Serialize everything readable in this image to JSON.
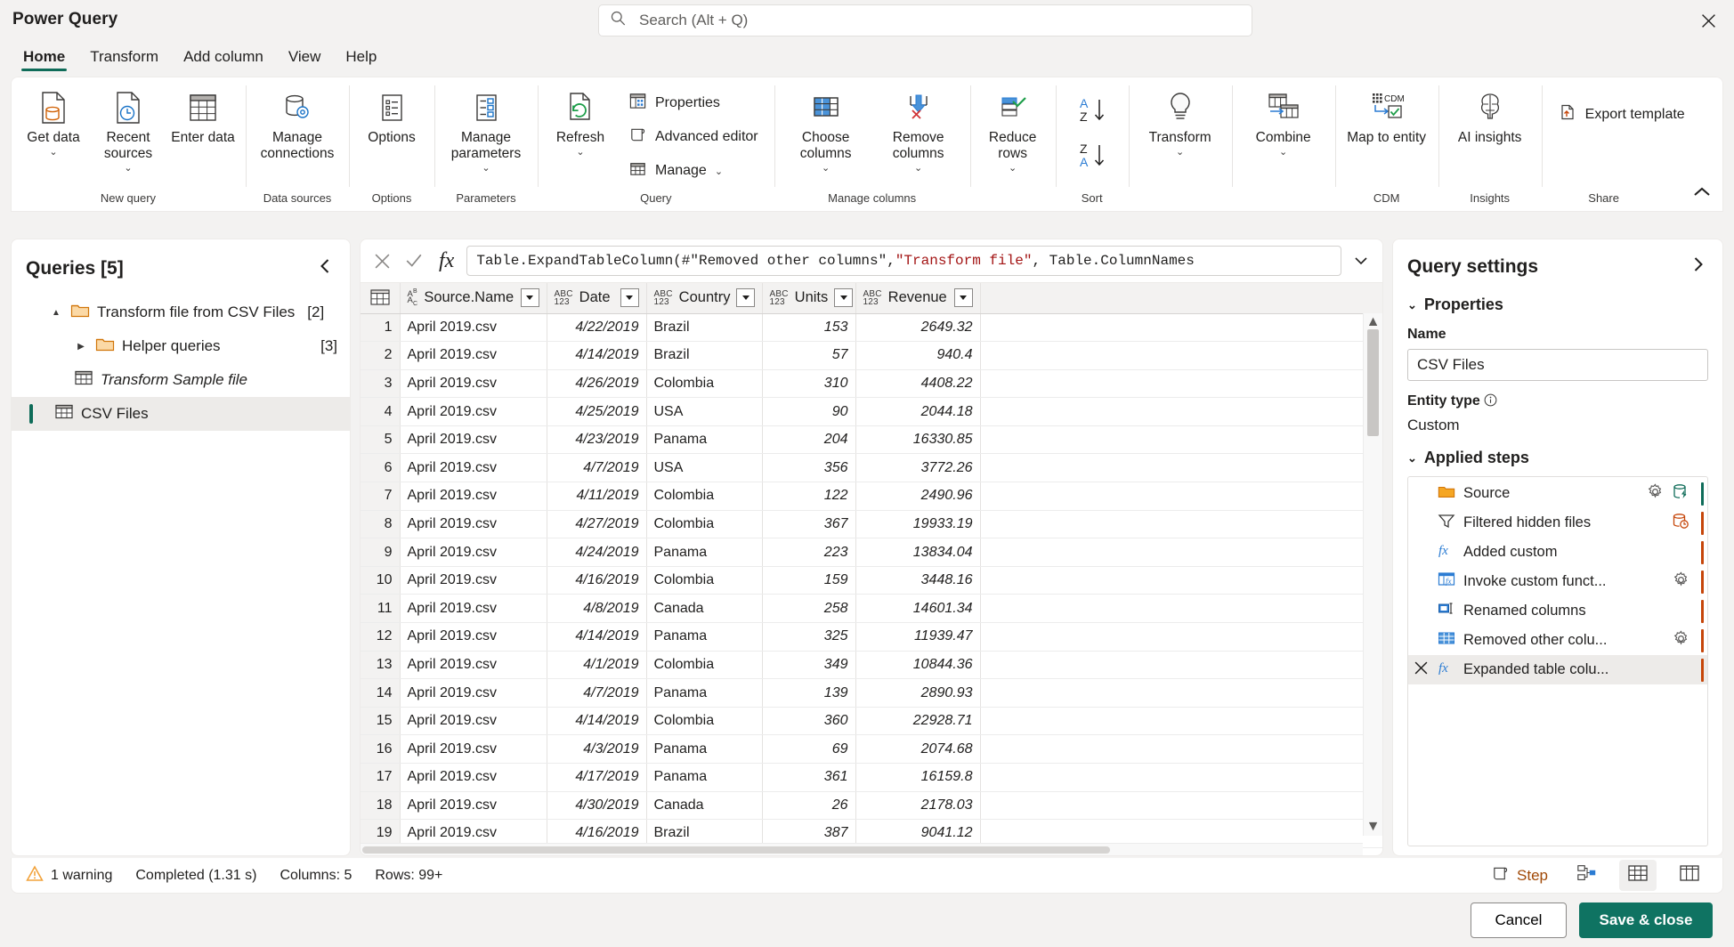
{
  "window": {
    "title": "Power Query",
    "close_label": "✕"
  },
  "search": {
    "placeholder": "Search (Alt + Q)",
    "icon": "search-icon"
  },
  "tabs": [
    {
      "label": "Home",
      "active": true
    },
    {
      "label": "Transform",
      "active": false
    },
    {
      "label": "Add column",
      "active": false
    },
    {
      "label": "View",
      "active": false
    },
    {
      "label": "Help",
      "active": false
    }
  ],
  "ribbon": {
    "collapse_icon": "chevron-up-icon",
    "groups": [
      {
        "name": "New query",
        "buttons": [
          {
            "label": "Get data",
            "caret": true,
            "icon": "get-data-icon"
          },
          {
            "label": "Recent sources",
            "caret": true,
            "icon": "recent-sources-icon"
          },
          {
            "label": "Enter data",
            "caret": false,
            "icon": "enter-data-icon"
          }
        ]
      },
      {
        "name": "Data sources",
        "buttons": [
          {
            "label": "Manage connections",
            "caret": false,
            "icon": "manage-connections-icon"
          }
        ]
      },
      {
        "name": "Options",
        "buttons": [
          {
            "label": "Options",
            "caret": false,
            "icon": "options-icon"
          }
        ]
      },
      {
        "name": "Parameters",
        "buttons": [
          {
            "label": "Manage parameters",
            "caret": true,
            "icon": "manage-parameters-icon"
          }
        ]
      },
      {
        "name": "Query",
        "buttons": [
          {
            "label": "Refresh",
            "caret": true,
            "icon": "refresh-icon"
          }
        ],
        "small_buttons": [
          {
            "label": "Properties",
            "icon": "properties-icon",
            "caret": false
          },
          {
            "label": "Advanced editor",
            "icon": "advanced-editor-icon",
            "caret": false
          },
          {
            "label": "Manage",
            "icon": "manage-icon",
            "caret": true
          }
        ]
      },
      {
        "name": "Manage columns",
        "buttons": [
          {
            "label": "Choose columns",
            "caret": true,
            "icon": "choose-columns-icon"
          },
          {
            "label": "Remove columns",
            "caret": true,
            "icon": "remove-columns-icon"
          }
        ]
      },
      {
        "name": "",
        "buttons": [
          {
            "label": "Reduce rows",
            "caret": true,
            "icon": "reduce-rows-icon"
          }
        ]
      },
      {
        "name": "Sort",
        "sort_buttons": [
          {
            "label": "sort-ascending",
            "icon": "sort-az-icon"
          },
          {
            "label": "sort-descending",
            "icon": "sort-za-icon"
          }
        ]
      },
      {
        "name": "",
        "buttons": [
          {
            "label": "Transform",
            "caret": true,
            "icon": "transform-bulb-icon"
          }
        ]
      },
      {
        "name": "",
        "buttons": [
          {
            "label": "Combine",
            "caret": true,
            "icon": "combine-icon"
          }
        ]
      },
      {
        "name": "CDM",
        "buttons": [
          {
            "label": "Map to entity",
            "caret": false,
            "icon": "map-to-entity-icon"
          }
        ]
      },
      {
        "name": "Insights",
        "buttons": [
          {
            "label": "AI insights",
            "caret": false,
            "icon": "ai-insights-icon"
          }
        ]
      },
      {
        "name": "Share",
        "small_buttons": [
          {
            "label": "Export template",
            "icon": "export-template-icon",
            "caret": false
          }
        ]
      }
    ]
  },
  "queries_pane": {
    "title": "Queries [5]",
    "collapse_icon": "chevron-left-icon",
    "items": [
      {
        "label": "Transform file from CSV Files",
        "count": "[2]",
        "icon": "folder-icon",
        "twisty": "▲",
        "indent": 1,
        "selected": false,
        "italic": false
      },
      {
        "label": "Helper queries",
        "count": "[3]",
        "icon": "folder-icon",
        "twisty": "▶",
        "indent": 2,
        "selected": false,
        "italic": false
      },
      {
        "label": "Transform Sample file",
        "count": "",
        "icon": "table-icon",
        "twisty": "",
        "indent": 2,
        "selected": false,
        "italic": true
      },
      {
        "label": "CSV Files",
        "count": "",
        "icon": "table-icon",
        "twisty": "",
        "indent": 1,
        "selected": true,
        "italic": false
      }
    ]
  },
  "formula_bar": {
    "cancel_icon": "cancel-icon",
    "accept_icon": "checkmark-icon",
    "fx_label": "fx",
    "expand_icon": "chevron-down-icon",
    "text_before": "Table.ExpandTableColumn(#\"Removed other columns\", ",
    "text_string": "\"Transform file\"",
    "text_after": ", Table.ColumnNames"
  },
  "grid": {
    "columns": [
      {
        "name": "Source.Name",
        "type_icon": "text-type-icon",
        "type_label": "ABC",
        "selected": true,
        "align": "left"
      },
      {
        "name": "Date",
        "type_icon": "any-type-icon",
        "type_label": "ABC123",
        "selected": false,
        "align": "right"
      },
      {
        "name": "Country",
        "type_icon": "any-type-icon",
        "type_label": "ABC123",
        "selected": false,
        "align": "left"
      },
      {
        "name": "Units",
        "type_icon": "any-type-icon",
        "type_label": "ABC123",
        "selected": false,
        "align": "right"
      },
      {
        "name": "Revenue",
        "type_icon": "any-type-icon",
        "type_label": "ABC123",
        "selected": false,
        "align": "right"
      }
    ],
    "rows": [
      {
        "n": "1",
        "source": "April 2019.csv",
        "date": "4/22/2019",
        "country": "Brazil",
        "units": "153",
        "revenue": "2649.32"
      },
      {
        "n": "2",
        "source": "April 2019.csv",
        "date": "4/14/2019",
        "country": "Brazil",
        "units": "57",
        "revenue": "940.4"
      },
      {
        "n": "3",
        "source": "April 2019.csv",
        "date": "4/26/2019",
        "country": "Colombia",
        "units": "310",
        "revenue": "4408.22"
      },
      {
        "n": "4",
        "source": "April 2019.csv",
        "date": "4/25/2019",
        "country": "USA",
        "units": "90",
        "revenue": "2044.18"
      },
      {
        "n": "5",
        "source": "April 2019.csv",
        "date": "4/23/2019",
        "country": "Panama",
        "units": "204",
        "revenue": "16330.85"
      },
      {
        "n": "6",
        "source": "April 2019.csv",
        "date": "4/7/2019",
        "country": "USA",
        "units": "356",
        "revenue": "3772.26"
      },
      {
        "n": "7",
        "source": "April 2019.csv",
        "date": "4/11/2019",
        "country": "Colombia",
        "units": "122",
        "revenue": "2490.96"
      },
      {
        "n": "8",
        "source": "April 2019.csv",
        "date": "4/27/2019",
        "country": "Colombia",
        "units": "367",
        "revenue": "19933.19"
      },
      {
        "n": "9",
        "source": "April 2019.csv",
        "date": "4/24/2019",
        "country": "Panama",
        "units": "223",
        "revenue": "13834.04"
      },
      {
        "n": "10",
        "source": "April 2019.csv",
        "date": "4/16/2019",
        "country": "Colombia",
        "units": "159",
        "revenue": "3448.16"
      },
      {
        "n": "11",
        "source": "April 2019.csv",
        "date": "4/8/2019",
        "country": "Canada",
        "units": "258",
        "revenue": "14601.34"
      },
      {
        "n": "12",
        "source": "April 2019.csv",
        "date": "4/14/2019",
        "country": "Panama",
        "units": "325",
        "revenue": "11939.47"
      },
      {
        "n": "13",
        "source": "April 2019.csv",
        "date": "4/1/2019",
        "country": "Colombia",
        "units": "349",
        "revenue": "10844.36"
      },
      {
        "n": "14",
        "source": "April 2019.csv",
        "date": "4/7/2019",
        "country": "Panama",
        "units": "139",
        "revenue": "2890.93"
      },
      {
        "n": "15",
        "source": "April 2019.csv",
        "date": "4/14/2019",
        "country": "Colombia",
        "units": "360",
        "revenue": "22928.71"
      },
      {
        "n": "16",
        "source": "April 2019.csv",
        "date": "4/3/2019",
        "country": "Panama",
        "units": "69",
        "revenue": "2074.68"
      },
      {
        "n": "17",
        "source": "April 2019.csv",
        "date": "4/17/2019",
        "country": "Panama",
        "units": "361",
        "revenue": "16159.8"
      },
      {
        "n": "18",
        "source": "April 2019.csv",
        "date": "4/30/2019",
        "country": "Canada",
        "units": "26",
        "revenue": "2178.03"
      },
      {
        "n": "19",
        "source": "April 2019.csv",
        "date": "4/16/2019",
        "country": "Brazil",
        "units": "387",
        "revenue": "9041.12"
      }
    ]
  },
  "query_settings": {
    "title": "Query settings",
    "expand_icon": "chevron-right-icon",
    "properties_section": "Properties",
    "name_label": "Name",
    "name_value": "CSV Files",
    "entity_label": "Entity type",
    "entity_value": "Custom",
    "applied_steps_section": "Applied steps",
    "steps": [
      {
        "label": "Source",
        "icon": "folder-icon",
        "gear": true,
        "extra_icon": "database-lightning-icon",
        "bar": "teal",
        "active": false,
        "deletable": false
      },
      {
        "label": "Filtered hidden files",
        "icon": "filter-icon",
        "gear": false,
        "extra_icon": "database-clock-icon",
        "bar": "orange",
        "active": false,
        "deletable": false
      },
      {
        "label": "Added custom",
        "icon": "fx-icon",
        "gear": false,
        "extra_icon": "",
        "bar": "orange",
        "active": false,
        "deletable": false
      },
      {
        "label": "Invoke custom funct...",
        "icon": "invoke-function-icon",
        "gear": true,
        "extra_icon": "",
        "bar": "orange",
        "active": false,
        "deletable": false
      },
      {
        "label": "Renamed columns",
        "icon": "rename-columns-icon",
        "gear": false,
        "extra_icon": "",
        "bar": "orange",
        "active": false,
        "deletable": false
      },
      {
        "label": "Removed other colu...",
        "icon": "removed-columns-icon",
        "gear": true,
        "extra_icon": "",
        "bar": "orange",
        "active": false,
        "deletable": false
      },
      {
        "label": "Expanded table colu...",
        "icon": "fx-icon",
        "gear": false,
        "extra_icon": "",
        "bar": "orange",
        "active": true,
        "deletable": true
      }
    ]
  },
  "status_bar": {
    "warning": "1 warning",
    "completed": "Completed (1.31 s)",
    "columns": "Columns: 5",
    "rows": "Rows: 99+",
    "step_label": "Step",
    "diagram_icon": "diagram-view-icon",
    "data_icon": "data-view-icon",
    "schema_icon": "schema-view-icon"
  },
  "footer": {
    "cancel": "Cancel",
    "save_close": "Save & close"
  },
  "colors": {
    "accent": "#0f7362",
    "tab_underline": "#0f6c59",
    "selected_column": "#cfe9e2",
    "step_bar": "#c6460a",
    "warning": "#f2a33c"
  }
}
